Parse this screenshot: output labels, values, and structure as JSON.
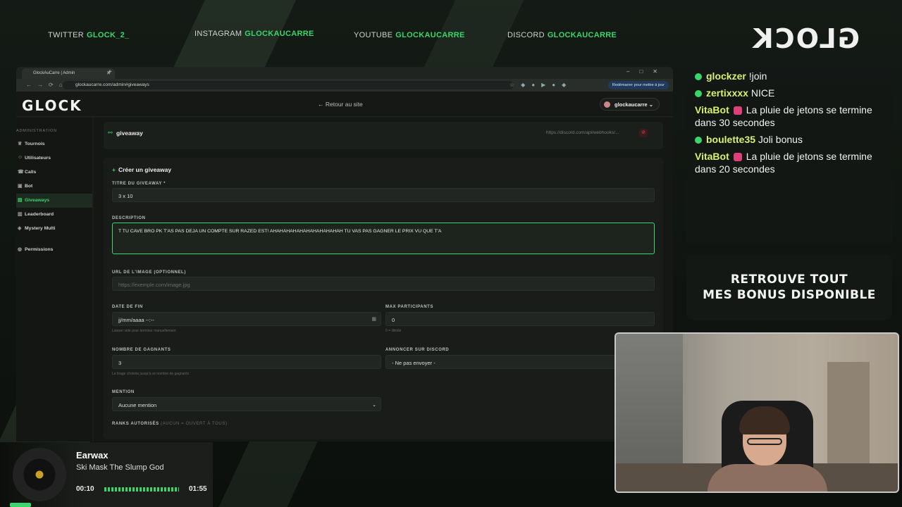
{
  "socials": [
    {
      "platform": "TWITTER",
      "handle": "GLOCK_2_"
    },
    {
      "platform": "INSTAGRAM",
      "handle": "GLOCKAUCARRE"
    },
    {
      "platform": "YOUTUBE",
      "handle": "GLOCKAUCARRE"
    },
    {
      "platform": "DISCORD",
      "handle": "GLOCKAUCARRE"
    }
  ],
  "overlay_logo": "GLOCK",
  "browser": {
    "tab_title": "GlockAuCarre | Admin",
    "url": "glockaucarre.com/admin#giveaways",
    "relaunch_label": "Redémarrer pour mettre à jour"
  },
  "app": {
    "brand": "GLOCK",
    "back_link": "← Retour au site",
    "user": "glockaucarre",
    "sidebar": {
      "section_title": "ADMINISTRATION",
      "items": [
        {
          "label": "Tournois",
          "icon": "trophy-icon"
        },
        {
          "label": "Utilisateurs",
          "icon": "users-icon"
        },
        {
          "label": "Calls",
          "icon": "phone-icon"
        },
        {
          "label": "Bot",
          "icon": "bot-icon"
        },
        {
          "label": "Giveaways",
          "icon": "gift-icon",
          "active": true
        },
        {
          "label": "Leaderboard",
          "icon": "chart-icon"
        },
        {
          "label": "Mystery Multi",
          "icon": "dice-icon"
        },
        {
          "label": "Permissions",
          "icon": "shield-icon"
        }
      ]
    },
    "webhook_card": {
      "title": "giveaway",
      "webhook": "https://discord.com/api/webhooks/..."
    },
    "form": {
      "title": "Créer un giveaway",
      "title_label": "TITRE DU GIVEAWAY *",
      "title_value": "3 x 10",
      "description_label": "DESCRIPTION",
      "description_value": "T TU CAVE BRO PK T'AS PAS DEJA UN COMPTE SUR RAZED EST! AHAHAHAHAHAHAHAHAHAHAH TU VAS PAS GAGNER LE PRIX VU QUE T'A",
      "image_label": "URL DE L'IMAGE (OPTIONNEL)",
      "image_placeholder": "https://exemple.com/image.jpg",
      "end_date_label": "DATE DE FIN",
      "end_date_value": "jj/mm/aaaa --:--",
      "end_date_hint": "Laisser vide pour terminer manuellement",
      "max_label": "MAX PARTICIPANTS",
      "max_value": "0",
      "max_hint": "0 = illimité",
      "winners_label": "NOMBRE DE GAGNANTS",
      "winners_value": "3",
      "winners_hint": "Le tirage choisira jusqu'à ce nombre de gagnants",
      "discord_label": "ANNONCER SUR DISCORD",
      "discord_value": "- Ne pas envoyer -",
      "mention_label": "MENTION",
      "mention_value": "Aucune mention",
      "ranks_label": "RANKS AUTORISÉS",
      "ranks_sub": "(AUCUN = OUVERT À TOUS)"
    }
  },
  "chat": [
    {
      "user": "glockzer",
      "text": "!join"
    },
    {
      "user": "zertixxxx",
      "text": "NICE"
    },
    {
      "user": "VitaBot",
      "text": "La pluie de jetons se termine dans 30 secondes"
    },
    {
      "user": "boulette35",
      "text": "Joli bonus"
    },
    {
      "user": "VitaBot",
      "text": "La pluie de jetons se termine dans 20 secondes"
    }
  ],
  "promo": {
    "line1": "RETROUVE TOUT",
    "line2": "MES BONUS DISPONIBLE"
  },
  "player": {
    "title": "Earwax",
    "artist": "Ski Mask The Slump God",
    "elapsed": "00:10",
    "duration": "01:55"
  },
  "colors": {
    "accent": "#3ad66b",
    "chat_user": "#d8f26b"
  }
}
